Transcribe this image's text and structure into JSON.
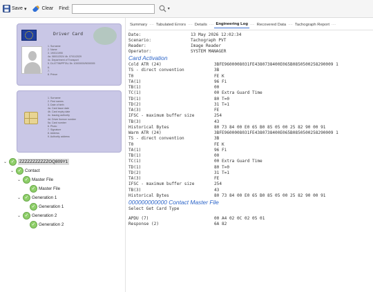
{
  "toolbar": {
    "save_label": "Save",
    "clear_label": "Clear",
    "find_label": "Find:",
    "find_value": ""
  },
  "cards": {
    "front_title": "Driver Card",
    "front_lines": [
      "1. Surname",
      "2. Name",
      "3. 19/01/1990",
      "4a. 08/01/2024  4b. 07/01/2029",
      "4c. Department of Transport",
      "5. DL47798/PPTAL  5b. 10000000/5000005",
      "6.",
      "7.",
      "8. Prince"
    ],
    "back_lines": [
      "1. Surname",
      "2. First names",
      "3. Date of birth",
      "4a. Card issue date",
      "4b. Card expiry date",
      "4c. Issuing authority",
      "4d. Driver licence number",
      "5a. Card number",
      "6. Photo",
      "7. Signature",
      "8. Address",
      "9. Authority address"
    ]
  },
  "tree": {
    "root": "ZZZZZZZZZZZOQ809Y1",
    "contact": "Contact",
    "master_file": "Master File",
    "master_file_child": "Master File",
    "gen1": "Generation 1",
    "gen1_child": "Generation 1",
    "gen2": "Generation 2",
    "gen2_child": "Generation 2"
  },
  "tabs": [
    {
      "label": "Summary"
    },
    {
      "label": "Tabulated Errors"
    },
    {
      "label": "Details"
    },
    {
      "label": "Engineering Log"
    },
    {
      "label": "Recovered Data"
    },
    {
      "label": "Tachograph Report"
    }
  ],
  "tab_separator": "····",
  "log": {
    "meta": [
      {
        "key": "Date:",
        "value": "13 May 2026 12:02:34"
      },
      {
        "key": "Scenario:",
        "value": "Tachograph PVT"
      },
      {
        "key": "Reader:",
        "value": "Image Reader"
      },
      {
        "key": "Operator:",
        "value": "SYSTEM MANAGER"
      }
    ],
    "section1": "Card Activation",
    "cold_atr": [
      {
        "key": "Cold ATR (24)",
        "value": "3BFE9600008031FE4380738400E065B0850500258290009 1"
      },
      {
        "key": "TS - direct convention",
        "value": "3B"
      },
      {
        "key": "T0",
        "value": "FE K"
      },
      {
        "key": "TA(1)",
        "value": "96 Fi"
      },
      {
        "key": "TB(1)",
        "value": "00"
      },
      {
        "key": "TC(1)",
        "value": "00 Extra Guard Time"
      },
      {
        "key": "TD(1)",
        "value": "80 T=0"
      },
      {
        "key": "TD(2)",
        "value": "31 T=1"
      },
      {
        "key": "TA(3)",
        "value": "FE"
      },
      {
        "key": "IFSC - maximum buffer size",
        "value": "254"
      },
      {
        "key": "TB(3)",
        "value": "43"
      },
      {
        "key": "Historical Bytes",
        "value": "80 73 84 00 E0 65 B0 85 05 00 25 82 90 00 91"
      }
    ],
    "warm_atr": [
      {
        "key": "Warm ATR (24)",
        "value": "3BFE9600008031FE4380738400E065B0850500258290009 1"
      },
      {
        "key": "TS - direct convention",
        "value": "3B"
      },
      {
        "key": "T0",
        "value": "FE K"
      },
      {
        "key": "TA(1)",
        "value": "96 Fi"
      },
      {
        "key": "TB(1)",
        "value": "00"
      },
      {
        "key": "TC(1)",
        "value": "00 Extra Guard Time"
      },
      {
        "key": "TD(1)",
        "value": "80 T=0"
      },
      {
        "key": "TD(2)",
        "value": "31 T=1"
      },
      {
        "key": "TA(3)",
        "value": "FE"
      },
      {
        "key": "IFSC - maximum buffer size",
        "value": "254"
      },
      {
        "key": "TB(3)",
        "value": "43"
      },
      {
        "key": "Historical Bytes",
        "value": "80 73 84 00 E0 65 B0 85 05 00 25 82 90 00 91"
      }
    ],
    "section2": "000000000000 Contact Master File",
    "select_line": "Select Get Card Type",
    "apdu": [
      {
        "key": "APDU (7)",
        "value": "00 A4 02 0C 02 05 01"
      },
      {
        "key": "Response (2)",
        "value": "6A 82"
      }
    ]
  },
  "colors": {
    "accent": "#2a63c8",
    "card_bg": "#c9c7e6",
    "check_green": "#8fcf6a"
  }
}
